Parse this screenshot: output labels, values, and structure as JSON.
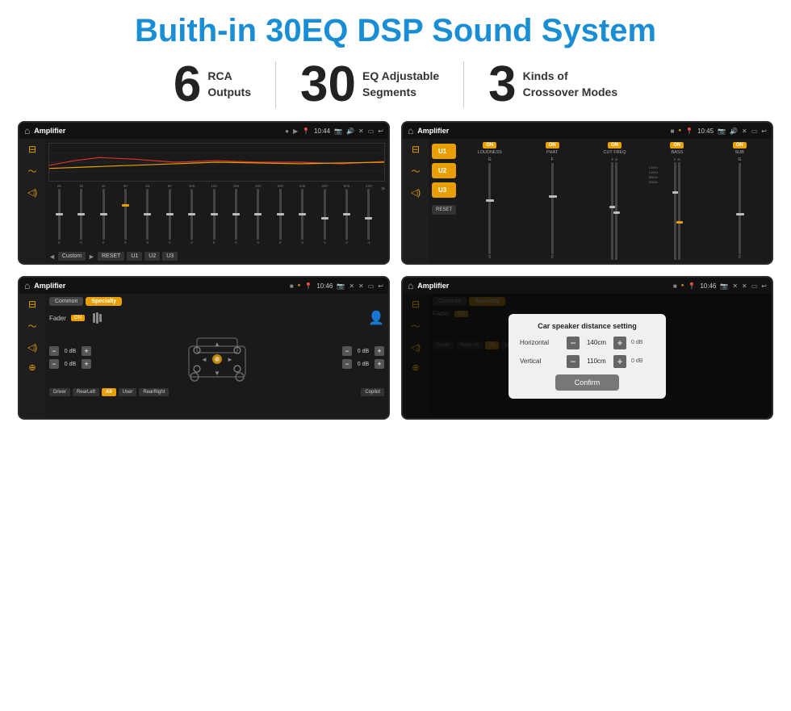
{
  "header": {
    "title": "Buith-in 30EQ DSP Sound System"
  },
  "stats": [
    {
      "number": "6",
      "label_line1": "RCA",
      "label_line2": "Outputs"
    },
    {
      "number": "30",
      "label_line1": "EQ Adjustable",
      "label_line2": "Segments"
    },
    {
      "number": "3",
      "label_line1": "Kinds of",
      "label_line2": "Crossover Modes"
    }
  ],
  "screens": {
    "eq": {
      "title": "Amplifier",
      "time": "10:44",
      "freqs": [
        "25",
        "32",
        "40",
        "50",
        "63",
        "80",
        "100",
        "125",
        "160",
        "200",
        "250",
        "320",
        "400",
        "500",
        "630"
      ],
      "values": [
        "0",
        "0",
        "0",
        "5",
        "0",
        "0",
        "0",
        "0",
        "0",
        "0",
        "0",
        "0",
        "-1",
        "0",
        "-1"
      ],
      "preset": "Custom",
      "buttons": [
        "U1",
        "U2",
        "U3",
        "RESET"
      ]
    },
    "crossover": {
      "title": "Amplifier",
      "time": "10:45",
      "presets": [
        "U1",
        "U2",
        "U3"
      ],
      "channels": [
        "LOUDNESS",
        "PHAT",
        "CUT FREQ",
        "BASS",
        "SUB"
      ],
      "reset_label": "RESET"
    },
    "fader": {
      "title": "Amplifier",
      "time": "10:46",
      "tabs": [
        "Common",
        "Specialty"
      ],
      "active_tab": "Specialty",
      "fader_label": "Fader",
      "fader_on": "ON",
      "values": [
        "0 dB",
        "0 dB",
        "0 dB",
        "0 dB"
      ],
      "bottom_btns": [
        "Driver",
        "RearLeft",
        "All",
        "User",
        "RearRight",
        "Copilot"
      ]
    },
    "dialog": {
      "title": "Amplifier",
      "time": "10:46",
      "tabs": [
        "Common",
        "Specialty"
      ],
      "dialog_title": "Car speaker distance setting",
      "horizontal_label": "Horizontal",
      "horizontal_value": "140cm",
      "vertical_label": "Vertical",
      "vertical_value": "110cm",
      "confirm_label": "Confirm",
      "bottom_btns": [
        "Driver",
        "RearLeft",
        "All",
        "User",
        "RearRight",
        "Copilot"
      ],
      "db_values": [
        "0 dB",
        "0 dB"
      ]
    }
  },
  "colors": {
    "accent": "#e8a000",
    "blue": "#1a8ed4",
    "dark_bg": "#111111",
    "sidebar_bg": "#222222"
  }
}
